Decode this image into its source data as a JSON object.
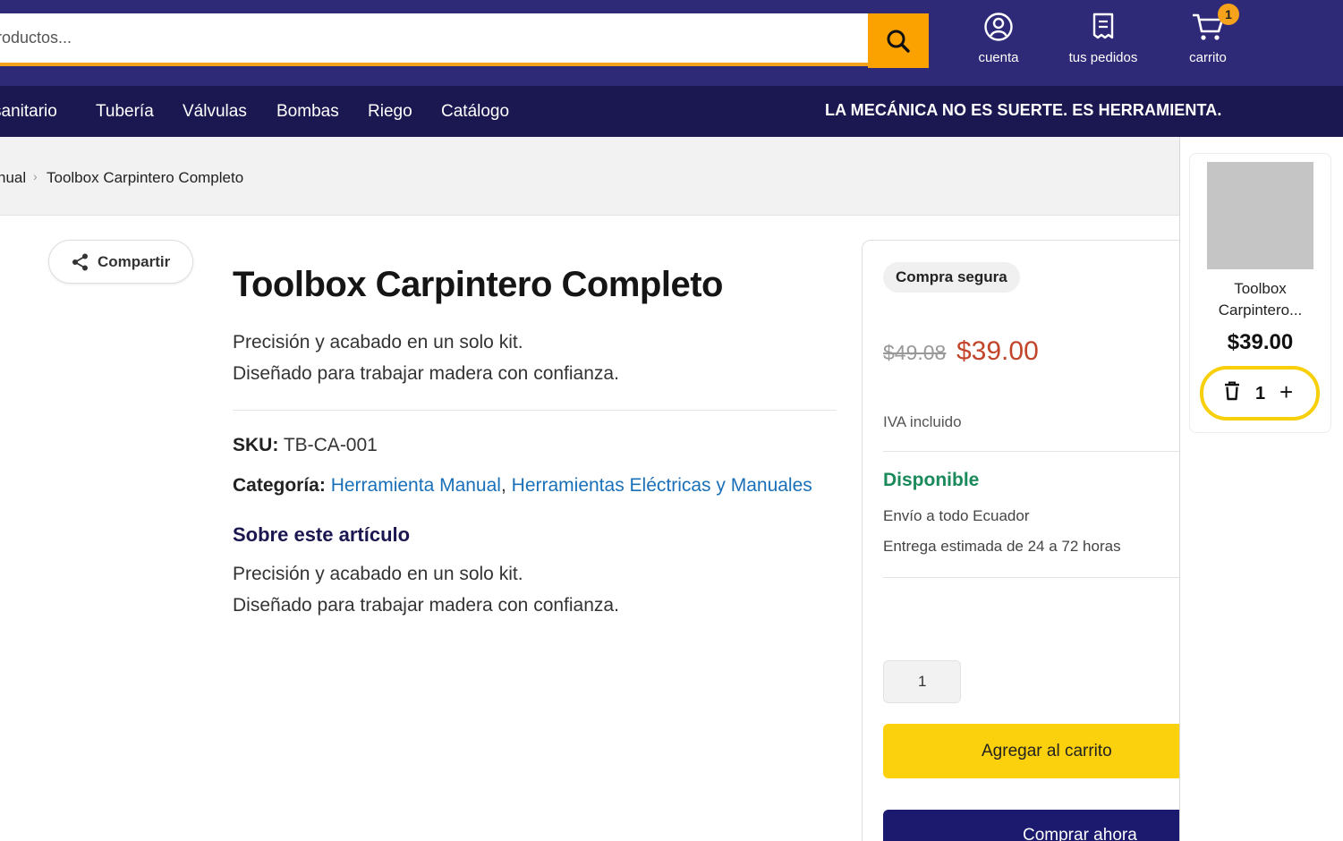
{
  "header": {
    "search_placeholder": "productos...",
    "links": {
      "account": "cuenta",
      "orders": "tus pedidos",
      "cart": "carrito"
    },
    "cart_count": "1",
    "accent_color": "#fba200",
    "bar_color": "#2f2a78"
  },
  "nav": {
    "items": [
      "sanitario",
      "Tubería",
      "Válvulas",
      "Bombas",
      "Riego",
      "Catálogo"
    ],
    "slogan": "LA MECÁNICA NO ES SUERTE. ES HERRAMIENTA."
  },
  "breadcrumb": {
    "parent": "nual",
    "separator": "›",
    "current": "Toolbox Carpintero Completo"
  },
  "share_label": "Compartir",
  "product": {
    "title": "Toolbox Carpintero Completo",
    "desc_line1": "Precisión y acabado en un solo kit.",
    "desc_line2": "Diseñado para trabajar madera con confianza.",
    "sku_label": "SKU:",
    "sku": "TB-CA-001",
    "category_label": "Categoría:",
    "category_1": "Herramienta Manual",
    "category_sep": ",",
    "category_2": "Herramientas Eléctricas y Manuales",
    "about_title": "Sobre este artículo",
    "about_line1": "Precisión y acabado en un solo kit.",
    "about_line2": "Diseñado para trabajar madera con confianza."
  },
  "buybox": {
    "secure_badge": "Compra segura",
    "old_price": "$49.08",
    "new_price": "$39.00",
    "tax_note": "IVA incluido",
    "availability": "Disponible",
    "shipping_1": "Envío a todo Ecuador",
    "shipping_2": "Entrega estimada de 24 a 72 horas",
    "quantity": "1",
    "add_to_cart": "Agregar al carrito",
    "buy_now": "Comprar ahora"
  },
  "side_cart": {
    "item_name_line1": "Toolbox",
    "item_name_line2": "Carpintero...",
    "item_price": "$39.00",
    "item_qty": "1",
    "plus": "+"
  }
}
